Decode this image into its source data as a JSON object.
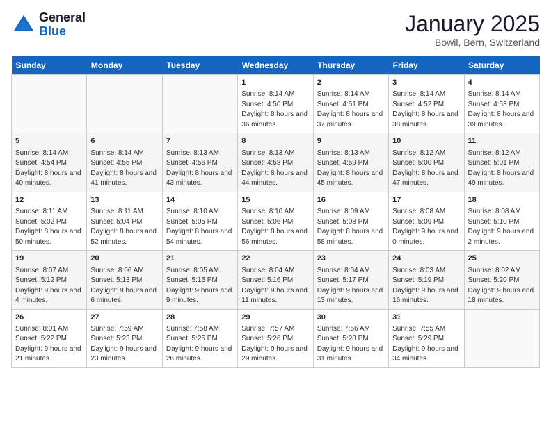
{
  "header": {
    "logo_general": "General",
    "logo_blue": "Blue",
    "month": "January 2025",
    "location": "Bowil, Bern, Switzerland"
  },
  "days_of_week": [
    "Sunday",
    "Monday",
    "Tuesday",
    "Wednesday",
    "Thursday",
    "Friday",
    "Saturday"
  ],
  "weeks": [
    [
      {
        "day": "",
        "info": ""
      },
      {
        "day": "",
        "info": ""
      },
      {
        "day": "",
        "info": ""
      },
      {
        "day": "1",
        "info": "Sunrise: 8:14 AM\nSunset: 4:50 PM\nDaylight: 8 hours and 36 minutes."
      },
      {
        "day": "2",
        "info": "Sunrise: 8:14 AM\nSunset: 4:51 PM\nDaylight: 8 hours and 37 minutes."
      },
      {
        "day": "3",
        "info": "Sunrise: 8:14 AM\nSunset: 4:52 PM\nDaylight: 8 hours and 38 minutes."
      },
      {
        "day": "4",
        "info": "Sunrise: 8:14 AM\nSunset: 4:53 PM\nDaylight: 8 hours and 39 minutes."
      }
    ],
    [
      {
        "day": "5",
        "info": "Sunrise: 8:14 AM\nSunset: 4:54 PM\nDaylight: 8 hours and 40 minutes."
      },
      {
        "day": "6",
        "info": "Sunrise: 8:14 AM\nSunset: 4:55 PM\nDaylight: 8 hours and 41 minutes."
      },
      {
        "day": "7",
        "info": "Sunrise: 8:13 AM\nSunset: 4:56 PM\nDaylight: 8 hours and 43 minutes."
      },
      {
        "day": "8",
        "info": "Sunrise: 8:13 AM\nSunset: 4:58 PM\nDaylight: 8 hours and 44 minutes."
      },
      {
        "day": "9",
        "info": "Sunrise: 8:13 AM\nSunset: 4:59 PM\nDaylight: 8 hours and 45 minutes."
      },
      {
        "day": "10",
        "info": "Sunrise: 8:12 AM\nSunset: 5:00 PM\nDaylight: 8 hours and 47 minutes."
      },
      {
        "day": "11",
        "info": "Sunrise: 8:12 AM\nSunset: 5:01 PM\nDaylight: 8 hours and 49 minutes."
      }
    ],
    [
      {
        "day": "12",
        "info": "Sunrise: 8:11 AM\nSunset: 5:02 PM\nDaylight: 8 hours and 50 minutes."
      },
      {
        "day": "13",
        "info": "Sunrise: 8:11 AM\nSunset: 5:04 PM\nDaylight: 8 hours and 52 minutes."
      },
      {
        "day": "14",
        "info": "Sunrise: 8:10 AM\nSunset: 5:05 PM\nDaylight: 8 hours and 54 minutes."
      },
      {
        "day": "15",
        "info": "Sunrise: 8:10 AM\nSunset: 5:06 PM\nDaylight: 8 hours and 56 minutes."
      },
      {
        "day": "16",
        "info": "Sunrise: 8:09 AM\nSunset: 5:08 PM\nDaylight: 8 hours and 58 minutes."
      },
      {
        "day": "17",
        "info": "Sunrise: 8:08 AM\nSunset: 5:09 PM\nDaylight: 9 hours and 0 minutes."
      },
      {
        "day": "18",
        "info": "Sunrise: 8:08 AM\nSunset: 5:10 PM\nDaylight: 9 hours and 2 minutes."
      }
    ],
    [
      {
        "day": "19",
        "info": "Sunrise: 8:07 AM\nSunset: 5:12 PM\nDaylight: 9 hours and 4 minutes."
      },
      {
        "day": "20",
        "info": "Sunrise: 8:06 AM\nSunset: 5:13 PM\nDaylight: 9 hours and 6 minutes."
      },
      {
        "day": "21",
        "info": "Sunrise: 8:05 AM\nSunset: 5:15 PM\nDaylight: 9 hours and 9 minutes."
      },
      {
        "day": "22",
        "info": "Sunrise: 8:04 AM\nSunset: 5:16 PM\nDaylight: 9 hours and 11 minutes."
      },
      {
        "day": "23",
        "info": "Sunrise: 8:04 AM\nSunset: 5:17 PM\nDaylight: 9 hours and 13 minutes."
      },
      {
        "day": "24",
        "info": "Sunrise: 8:03 AM\nSunset: 5:19 PM\nDaylight: 9 hours and 16 minutes."
      },
      {
        "day": "25",
        "info": "Sunrise: 8:02 AM\nSunset: 5:20 PM\nDaylight: 9 hours and 18 minutes."
      }
    ],
    [
      {
        "day": "26",
        "info": "Sunrise: 8:01 AM\nSunset: 5:22 PM\nDaylight: 9 hours and 21 minutes."
      },
      {
        "day": "27",
        "info": "Sunrise: 7:59 AM\nSunset: 5:23 PM\nDaylight: 9 hours and 23 minutes."
      },
      {
        "day": "28",
        "info": "Sunrise: 7:58 AM\nSunset: 5:25 PM\nDaylight: 9 hours and 26 minutes."
      },
      {
        "day": "29",
        "info": "Sunrise: 7:57 AM\nSunset: 5:26 PM\nDaylight: 9 hours and 29 minutes."
      },
      {
        "day": "30",
        "info": "Sunrise: 7:56 AM\nSunset: 5:28 PM\nDaylight: 9 hours and 31 minutes."
      },
      {
        "day": "31",
        "info": "Sunrise: 7:55 AM\nSunset: 5:29 PM\nDaylight: 9 hours and 34 minutes."
      },
      {
        "day": "",
        "info": ""
      }
    ]
  ]
}
